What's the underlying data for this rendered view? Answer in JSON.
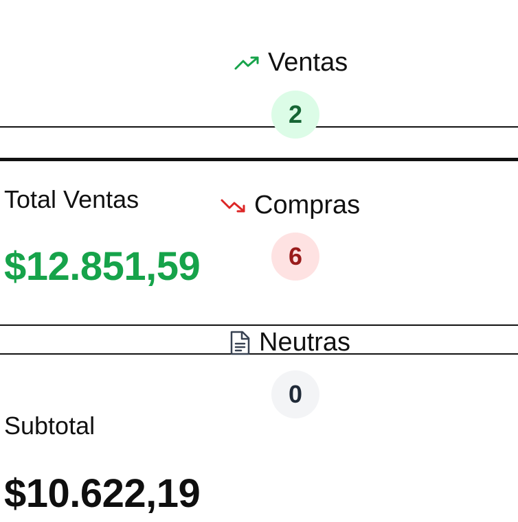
{
  "counters": {
    "ventas": {
      "label": "Ventas",
      "count": "2",
      "icon": "trending-up-icon",
      "color": "#16a34a",
      "badge_bg": "#dcfce7",
      "badge_fg": "#166534"
    },
    "compras": {
      "label": "Compras",
      "count": "6",
      "icon": "trending-down-icon",
      "color": "#dc2626",
      "badge_bg": "#fee2e2",
      "badge_fg": "#991b1b"
    },
    "neutras": {
      "label": "Neutras",
      "count": "0",
      "icon": "document-icon",
      "color": "#374151",
      "badge_bg": "#f3f4f6",
      "badge_fg": "#1f2937"
    }
  },
  "totals": {
    "total_ventas": {
      "label": "Total Ventas",
      "value": "$12.851,59",
      "color": "#16a34a"
    },
    "subtotal": {
      "label": "Subtotal",
      "value": "$10.622,19",
      "color": "#0f0f0f"
    }
  }
}
